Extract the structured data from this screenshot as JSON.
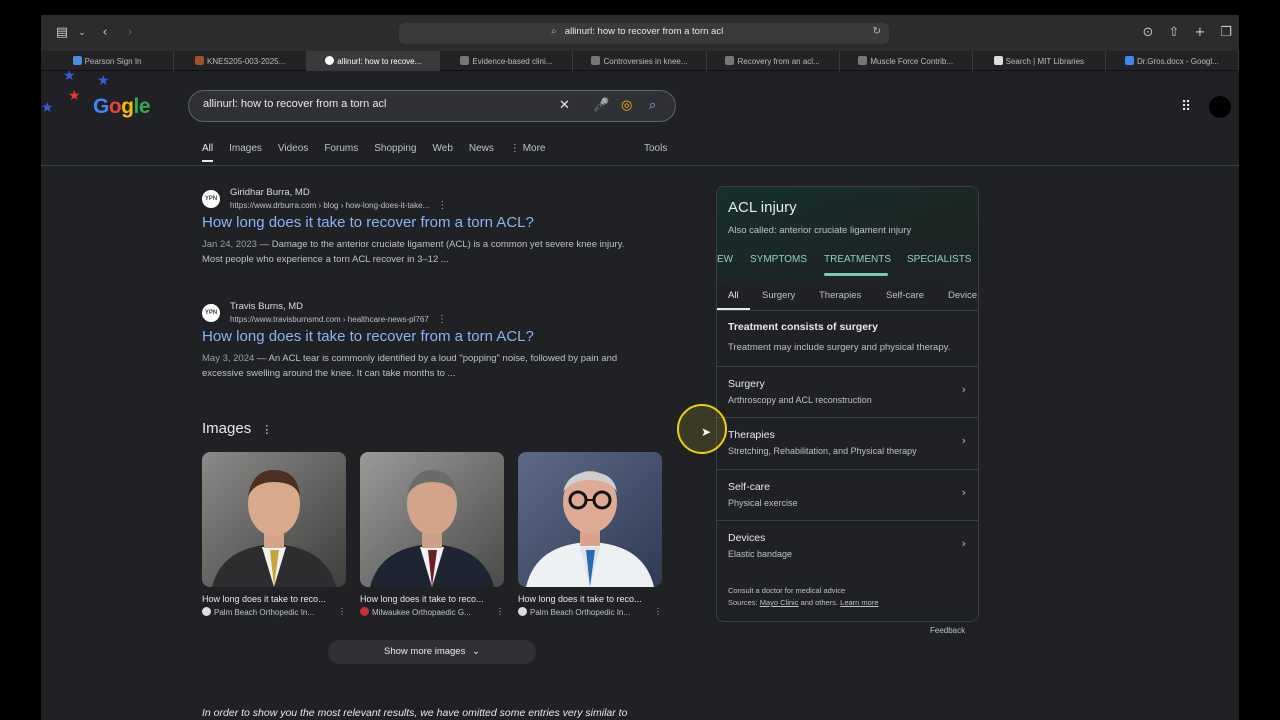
{
  "browser": {
    "address_text": "allinurl: how to recover from a torn acl",
    "tabs": [
      {
        "label": "Pearson Sign In",
        "active": false
      },
      {
        "label": "KNES205-003-2025...",
        "active": false
      },
      {
        "label": "allinurl: how to recove...",
        "active": true
      },
      {
        "label": "Evidence-based clini...",
        "active": false
      },
      {
        "label": "Controversies in knee...",
        "active": false
      },
      {
        "label": "Recovery from an acl...",
        "active": false
      },
      {
        "label": "Muscle Force Contrib...",
        "active": false
      },
      {
        "label": "Search | MIT Libraries",
        "active": false
      },
      {
        "label": "Dr.Gros.docx - Googl...",
        "active": false
      }
    ]
  },
  "google": {
    "logo": {
      "g1": "G",
      "g2": "o",
      "g3": "g",
      "g4": "le"
    },
    "query": "allinurl: how to recover from a torn acl",
    "tabs": [
      "All",
      "Images",
      "Videos",
      "Forums",
      "Shopping",
      "Web",
      "News",
      "More"
    ],
    "tools": "Tools"
  },
  "results": [
    {
      "favicon": "YPN",
      "site": "Giridhar Burra, MD",
      "url": "https://www.drburra.com › blog › how-long-does-it-take...",
      "title": "How long does it take to recover from a torn ACL?",
      "date": "Jan 24, 2023",
      "snippet": " — Damage to the anterior cruciate ligament (ACL) is a common yet severe knee injury. Most people who experience a torn ACL recover in 3–12 ..."
    },
    {
      "favicon": "YPN",
      "site": "Travis Burns, MD",
      "url": "https://www.travisburnsmd.com › healthcare-news-pl767",
      "title": "How long does it take to recover from a torn ACL?",
      "date": "May 3, 2024",
      "snippet": " — An ACL tear is commonly identified by a loud \"popping\" noise, followed by pain and excessive swelling around the knee. It can take months to ..."
    }
  ],
  "images": {
    "heading": "Images",
    "cards": [
      {
        "caption": "How long does it take to reco...",
        "source": "Palm Beach Orthopedic In..."
      },
      {
        "caption": "How long does it take to reco...",
        "source": "Milwaukee Orthopaedic G..."
      },
      {
        "caption": "How long does it take to reco...",
        "source": "Palm Beach Orthopedic In..."
      }
    ],
    "show_more": "Show more images"
  },
  "omitted_text": "In order to show you the most relevant results, we have omitted some entries very similar to",
  "knowledge_panel": {
    "title": "ACL injury",
    "subtitle": "Also called: anterior cruciate ligament injury",
    "tabs": [
      "EW",
      "SYMPTOMS",
      "TREATMENTS",
      "SPECIALISTS"
    ],
    "chips": [
      "All",
      "Surgery",
      "Therapies",
      "Self-care",
      "Device"
    ],
    "heading": "Treatment consists of surgery",
    "description": "Treatment may include surgery and physical therapy.",
    "rows": [
      {
        "title": "Surgery",
        "sub": "Arthroscopy and ACL reconstruction"
      },
      {
        "title": "Therapies",
        "sub": "Stretching, Rehabilitation, and Physical therapy"
      },
      {
        "title": "Self-care",
        "sub": "Physical exercise"
      },
      {
        "title": "Devices",
        "sub": "Elastic bandage"
      }
    ],
    "footer1": "Consult a doctor for medical advice",
    "footer2_prefix": "Sources: ",
    "footer2_link": "Mayo Clinic",
    "footer2_mid": " and others. ",
    "footer2_learn": "Learn more"
  },
  "feedback": "Feedback",
  "colors": {
    "link": "#8ab4f8",
    "accent_teal": "#8fd1c8"
  }
}
